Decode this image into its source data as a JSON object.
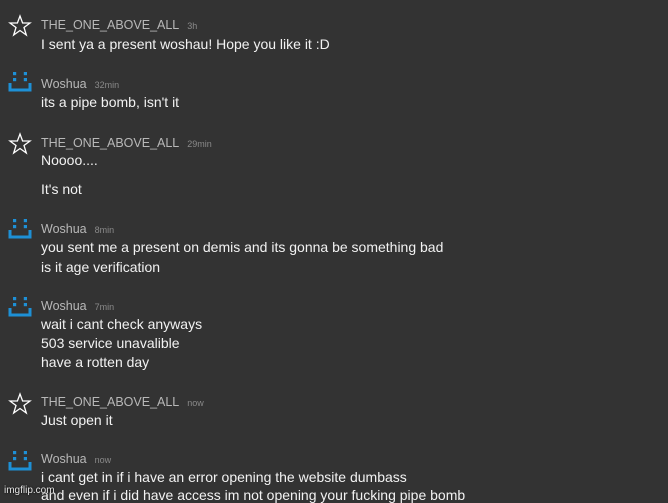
{
  "messages": [
    {
      "author": "THE_ONE_ABOVE_ALL",
      "time": "3h",
      "avatar_icon": "star-outline-icon",
      "lines": [
        "I sent ya a present woshau! Hope you like it :D"
      ]
    },
    {
      "author": "Woshua",
      "time": "32min",
      "avatar_icon": "robot-face-icon",
      "lines": [
        "its a pipe bomb, isn't it"
      ]
    },
    {
      "author": "THE_ONE_ABOVE_ALL",
      "time": "29min",
      "avatar_icon": "star-outline-icon",
      "lines": [
        "Noooo....",
        "It's not"
      ]
    },
    {
      "author": "Woshua",
      "time": "8min",
      "avatar_icon": "robot-face-icon",
      "lines": [
        "you sent me a present on demis and its gonna be something bad",
        "is it age verification"
      ]
    },
    {
      "author": "Woshua",
      "time": "7min",
      "avatar_icon": "robot-face-icon",
      "lines": [
        "wait i cant check anyways",
        "503 service unavalible",
        "have a rotten day"
      ]
    },
    {
      "author": "THE_ONE_ABOVE_ALL",
      "time": "now",
      "avatar_icon": "star-outline-icon",
      "lines": [
        "Just open it"
      ]
    },
    {
      "author": "Woshua",
      "time": "now",
      "avatar_icon": "robot-face-icon",
      "lines": [
        "i cant get in if i have an error opening the website dumbass",
        "and even if i did have access im not opening your fucking pipe bomb"
      ]
    }
  ],
  "watermark": "imgflip.com",
  "colors": {
    "background": "#333333",
    "text": "#f2f2f2",
    "author": "#b8b8b8",
    "timestamp": "#8a8a8a",
    "robot_icon": "#1e90d6"
  }
}
